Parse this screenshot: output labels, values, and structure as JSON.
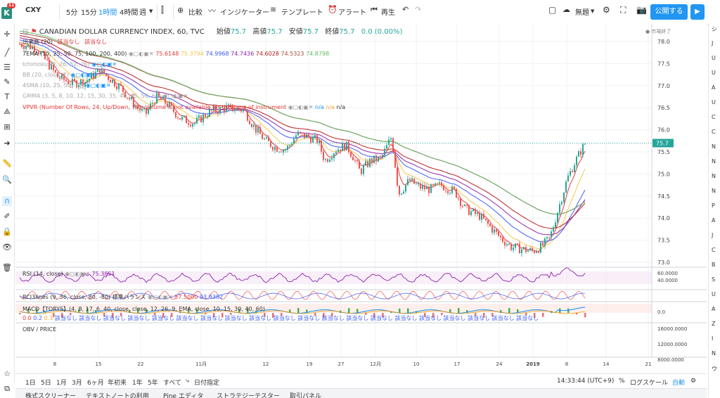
{
  "toolbar": {
    "symbol": "CXY",
    "intervals": [
      "5分",
      "15分",
      "1時間",
      "4時間",
      "週"
    ],
    "active_interval": "1時間",
    "compare": "比較",
    "indicators": "インジケーター",
    "templates": "テンプレート",
    "alert": "アラート",
    "replay": "再生",
    "layout_name": "無題",
    "publish": "公開する",
    "notification_count": "11"
  },
  "header": {
    "title": "CANADIAN DOLLAR CURRENCY INDEX, 60, TVC",
    "open_label": "始値",
    "open": "75.7",
    "high_label": "高値",
    "high": "75.7",
    "low_label": "安値",
    "low": "75.7",
    "close_label": "終値",
    "close": "75.7",
    "change": "0.0 (0.00%)",
    "market_status": "市場終了"
  },
  "legends": {
    "volume": {
      "label": "出来高 (20)",
      "v1": "該当なし",
      "v2": "該当なし"
    },
    "ema": {
      "label": "7EMA (10, 25, 50, 75, 100, 200, 400)",
      "values": [
        "75.6148",
        "75.3794",
        "74.9968",
        "74.7436",
        "74.6028",
        "74.5323",
        "74.8798"
      ],
      "colors": [
        "#e53935",
        "#f2c94c",
        "#3d5afe",
        "#8e24aa",
        "#b71c1c",
        "#a84c3f",
        "#66bb6a"
      ]
    },
    "ichimoku": {
      "label": "Ichimoku (9, 26, 52, 26)"
    },
    "bb": {
      "label": "BB (20, close, 2)"
    },
    "sma": {
      "label": "4SMA (10, 25, 50, 75)"
    },
    "gmma": {
      "label": "GMMA (3, 5, 8, 10, 12, 15, 30, 35, 40, 45, 50, 60)"
    },
    "vpvr": {
      "label": "VPVR (Number Of Rows, 24, Up/Down, 70): Volume is not available for this type of instrument",
      "v1": "n/a",
      "v2": "n/a",
      "v3": "n/a"
    }
  },
  "indicator_panes": {
    "rsi": {
      "label": "RSI (14, close)",
      "value": "75.3851",
      "scale": [
        "60.0000",
        "40.0000"
      ]
    },
    "rci": {
      "label": "RCI3lines (9, 36, close, 80, -80) 標準バランス",
      "v1": "57.5000",
      "v2": "93.9382"
    },
    "macd": {
      "label": "MACD【TORYS】(4, 8, 17, 6, 40, close, close, 12, 26, 9, EMA, close, 10, 15, 30, 40, 60)",
      "values": [
        "0.0",
        "0.2",
        "0.3"
      ],
      "na": "該当なし",
      "scale": [
        "0.0"
      ]
    },
    "obv": {
      "label": "OBV / PRICE",
      "scale": [
        "16000.0000",
        "12000.0000",
        "8000.0000"
      ]
    }
  },
  "price_axis": [
    "78.0",
    "77.5",
    "77.0",
    "76.5",
    "76.0",
    "75.5",
    "75.0",
    "74.5",
    "74.0",
    "73.5",
    "73.0"
  ],
  "last_price": "75.7",
  "time_axis": [
    "8",
    "15",
    "22",
    "11月",
    "12",
    "19",
    "27",
    "12月",
    "10",
    "17",
    "24",
    "2019",
    "8",
    "14",
    "21"
  ],
  "bottom": {
    "ranges": [
      "1日",
      "5日",
      "1月",
      "3月",
      "6ヶ月",
      "年初来",
      "1年",
      "5年",
      "すべて"
    ],
    "goto_date": "日付指定",
    "time": "14:33:44 (UTC+9)",
    "percent": "%",
    "log": "ログスケール",
    "auto": "自動"
  },
  "bottom_tabs": [
    "株式スクリーナー",
    "テキストノートの利用",
    "Pine エディタ",
    "ストラテジーテスター",
    "取引パネル"
  ],
  "right_strip": [
    "シ",
    "J",
    "U",
    "U",
    "A",
    "U",
    "C",
    "C",
    "N",
    "N",
    "N",
    "N",
    "P",
    "A",
    "J",
    "C",
    "B",
    "S",
    "U",
    "A",
    "Z",
    "I",
    "N",
    "ウ"
  ]
}
